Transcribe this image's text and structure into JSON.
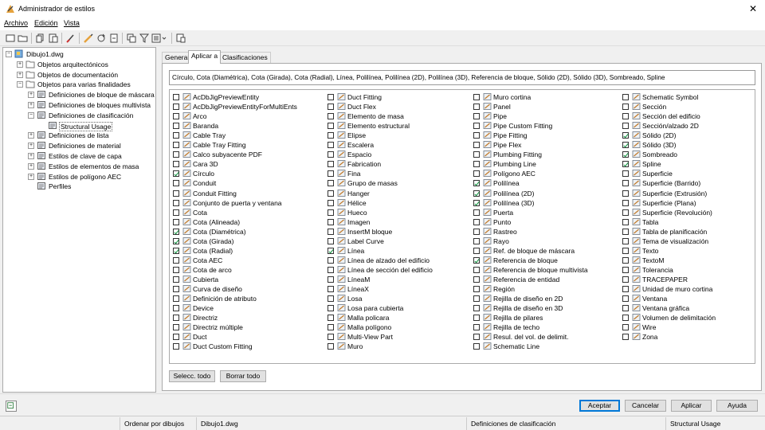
{
  "window": {
    "title": "Administrador de estilos",
    "close_glyph": "✕",
    "icon": "style-manager-icon"
  },
  "menu": [
    {
      "label": "Archivo"
    },
    {
      "label": "Edición"
    },
    {
      "label": "Vista"
    }
  ],
  "toolbar": {
    "icons": [
      "new-drawing-icon",
      "open-drawing-icon",
      "copy-icon",
      "paste-icon",
      "purge-icon",
      "edit-style-icon",
      "synchronize-icon",
      "update-icon",
      "toggle-view-icon",
      "filter-icon",
      "view-options-icon",
      "help-icon"
    ]
  },
  "tree": {
    "nodes": [
      {
        "label": "Dibujo1.dwg",
        "icon": "drawing-icon",
        "expander": "−",
        "level": 0
      },
      {
        "label": "Objetos arquitectónicos",
        "icon": "folder-icon",
        "expander": "+",
        "level": 1
      },
      {
        "label": "Objetos de documentación",
        "icon": "folder-icon",
        "expander": "+",
        "level": 1
      },
      {
        "label": "Objetos para varias finalidades",
        "icon": "folder-icon",
        "expander": "−",
        "level": 1
      },
      {
        "label": "Definiciones de bloque de máscara",
        "icon": "mask-block-icon",
        "expander": "+",
        "level": 2
      },
      {
        "label": "Definiciones de bloques multivista",
        "icon": "multiview-block-icon",
        "expander": "+",
        "level": 2
      },
      {
        "label": "Definiciones de clasificación",
        "icon": "classification-icon",
        "expander": "−",
        "level": 2
      },
      {
        "label": "Structural Usage",
        "icon": "classification-item-icon",
        "expander": "",
        "level": 3,
        "selected": true
      },
      {
        "label": "Definiciones de lista",
        "icon": "list-icon",
        "expander": "+",
        "level": 2
      },
      {
        "label": "Definiciones de material",
        "icon": "material-icon",
        "expander": "+",
        "level": 2
      },
      {
        "label": "Estilos de clave de capa",
        "icon": "layer-key-icon",
        "expander": "+",
        "level": 2
      },
      {
        "label": "Estilos de elementos de masa",
        "icon": "mass-element-icon",
        "expander": "+",
        "level": 2
      },
      {
        "label": "Estilos de polígono AEC",
        "icon": "aec-polygon-icon",
        "expander": "+",
        "level": 2
      },
      {
        "label": "Perfiles",
        "icon": "profile-icon",
        "expander": "",
        "level": 2
      }
    ]
  },
  "tabs": [
    {
      "label": "General",
      "active": false
    },
    {
      "label": "Aplicar a",
      "active": true
    },
    {
      "label": "Clasificaciones",
      "active": false
    }
  ],
  "applies_to_text": "Círculo, Cota (Diamétrica), Cota (Girada), Cota (Radial), Línea, Polilínea, Polilínea (2D), Polilínea (3D), Referencia de bloque, Sólido (2D), Sólido (3D), Sombreado, Spline",
  "objects": {
    "columns": [
      [
        {
          "label": "AcDbJigPreviewEntity",
          "checked": false,
          "icon": "pencil-icon"
        },
        {
          "label": "AcDbJigPreviewEntityForMultiEnts",
          "checked": false,
          "icon": "pencil-icon"
        },
        {
          "label": "Arco",
          "checked": false,
          "icon": "arc-icon"
        },
        {
          "label": "Baranda",
          "checked": false,
          "icon": "railing-icon"
        },
        {
          "label": "Cable Tray",
          "checked": false,
          "icon": "cable-tray-icon"
        },
        {
          "label": "Cable Tray Fitting",
          "checked": false,
          "icon": "cable-tray-fitting-icon"
        },
        {
          "label": "Calco subyacente PDF",
          "checked": false,
          "icon": "pdf-underlay-icon"
        },
        {
          "label": "Cara 3D",
          "checked": false,
          "icon": "face-3d-icon"
        },
        {
          "label": "Círculo",
          "checked": true,
          "icon": "circle-icon"
        },
        {
          "label": "Conduit",
          "checked": false,
          "icon": "conduit-icon"
        },
        {
          "label": "Conduit Fitting",
          "checked": false,
          "icon": "conduit-fitting-icon"
        },
        {
          "label": "Conjunto de puerta y ventana",
          "checked": false,
          "icon": "door-window-assembly-icon"
        },
        {
          "label": "Cota",
          "checked": false,
          "icon": "dimension-icon"
        },
        {
          "label": "Cota (Alineada)",
          "checked": false,
          "icon": "dimension-icon"
        },
        {
          "label": "Cota (Diamétrica)",
          "checked": true,
          "icon": "dimension-icon"
        },
        {
          "label": "Cota (Girada)",
          "checked": true,
          "icon": "dimension-icon"
        },
        {
          "label": "Cota (Radial)",
          "checked": true,
          "icon": "dimension-icon"
        },
        {
          "label": "Cota AEC",
          "checked": false,
          "icon": "aec-dimension-icon"
        },
        {
          "label": "Cota de arco",
          "checked": false,
          "icon": "arc-dimension-icon"
        },
        {
          "label": "Cubierta",
          "checked": false,
          "icon": "roof-icon"
        },
        {
          "label": "Curva de diseño",
          "checked": false,
          "icon": "layout-curve-icon"
        },
        {
          "label": "Definición de atributo",
          "checked": false,
          "icon": "attribute-icon"
        },
        {
          "label": "Device",
          "checked": false,
          "icon": "device-icon"
        },
        {
          "label": "Directriz",
          "checked": false,
          "icon": "leader-icon"
        },
        {
          "label": "Directriz múltiple",
          "checked": false,
          "icon": "multileader-icon"
        },
        {
          "label": "Duct",
          "checked": false,
          "icon": "duct-icon"
        },
        {
          "label": "Duct Custom Fitting",
          "checked": false,
          "icon": "duct-fitting-icon"
        }
      ],
      [
        {
          "label": "Duct Fitting",
          "checked": false,
          "icon": "duct-fitting-icon"
        },
        {
          "label": "Duct Flex",
          "checked": false,
          "icon": "duct-flex-icon"
        },
        {
          "label": "Elemento de masa",
          "checked": false,
          "icon": "mass-element-icon"
        },
        {
          "label": "Elemento estructural",
          "checked": false,
          "icon": "structural-member-icon"
        },
        {
          "label": "Elipse",
          "checked": false,
          "icon": "ellipse-icon"
        },
        {
          "label": "Escalera",
          "checked": false,
          "icon": "stair-icon"
        },
        {
          "label": "Espacio",
          "checked": false,
          "icon": "space-icon"
        },
        {
          "label": "Fabrication",
          "checked": false,
          "icon": "fabrication-icon"
        },
        {
          "label": "Fina",
          "checked": false,
          "icon": "bulb-icon"
        },
        {
          "label": "Grupo de masas",
          "checked": false,
          "icon": "mass-group-icon"
        },
        {
          "label": "Hanger",
          "checked": false,
          "icon": "hanger-icon"
        },
        {
          "label": "Hélice",
          "checked": false,
          "icon": "helix-icon"
        },
        {
          "label": "Hueco",
          "checked": false,
          "icon": "opening-icon"
        },
        {
          "label": "Imagen",
          "checked": false,
          "icon": "image-icon"
        },
        {
          "label": "InsertM bloque",
          "checked": false,
          "icon": "minsert-icon"
        },
        {
          "label": "Label Curve",
          "checked": false,
          "icon": "label-curve-icon"
        },
        {
          "label": "Línea",
          "checked": true,
          "icon": "line-icon"
        },
        {
          "label": "Línea de alzado del edificio",
          "checked": false,
          "icon": "elevation-line-icon"
        },
        {
          "label": "Línea de sección del edificio",
          "checked": false,
          "icon": "section-line-icon"
        },
        {
          "label": "LíneaM",
          "checked": false,
          "icon": "mline-icon"
        },
        {
          "label": "LíneaX",
          "checked": false,
          "icon": "xline-icon"
        },
        {
          "label": "Losa",
          "checked": false,
          "icon": "slab-icon"
        },
        {
          "label": "Losa para cubierta",
          "checked": false,
          "icon": "roof-slab-icon"
        },
        {
          "label": "Malla policara",
          "checked": false,
          "icon": "polyface-mesh-icon"
        },
        {
          "label": "Malla polígono",
          "checked": false,
          "icon": "polygon-mesh-icon"
        },
        {
          "label": "Multi-View Part",
          "checked": false,
          "icon": "multiview-part-icon"
        },
        {
          "label": "Muro",
          "checked": false,
          "icon": "wall-icon"
        }
      ],
      [
        {
          "label": "Muro cortina",
          "checked": false,
          "icon": "curtain-wall-icon"
        },
        {
          "label": "Panel",
          "checked": false,
          "icon": "panel-icon"
        },
        {
          "label": "Pipe",
          "checked": false,
          "icon": "pipe-icon"
        },
        {
          "label": "Pipe Custom Fitting",
          "checked": false,
          "icon": "pipe-fitting-icon"
        },
        {
          "label": "Pipe Fitting",
          "checked": false,
          "icon": "pipe-fitting-icon"
        },
        {
          "label": "Pipe Flex",
          "checked": false,
          "icon": "pipe-flex-icon"
        },
        {
          "label": "Plumbing Fitting",
          "checked": false,
          "icon": "plumbing-fitting-icon"
        },
        {
          "label": "Plumbing Line",
          "checked": false,
          "icon": "plumbing-line-icon"
        },
        {
          "label": "Polígono AEC",
          "checked": false,
          "icon": "aec-polygon-icon"
        },
        {
          "label": "Polilínea",
          "checked": true,
          "icon": "polyline-icon"
        },
        {
          "label": "Polilínea (2D)",
          "checked": true,
          "icon": "polyline-icon"
        },
        {
          "label": "Polilínea (3D)",
          "checked": true,
          "icon": "polyline-icon"
        },
        {
          "label": "Puerta",
          "checked": false,
          "icon": "door-icon"
        },
        {
          "label": "Punto",
          "checked": false,
          "icon": "point-icon"
        },
        {
          "label": "Rastreo",
          "checked": false,
          "icon": "trace-icon"
        },
        {
          "label": "Rayo",
          "checked": false,
          "icon": "ray-icon"
        },
        {
          "label": "Ref. de bloque de máscara",
          "checked": false,
          "icon": "mask-block-ref-icon"
        },
        {
          "label": "Referencia de bloque",
          "checked": true,
          "icon": "block-ref-icon"
        },
        {
          "label": "Referencia de bloque multivista",
          "checked": false,
          "icon": "multiview-block-ref-icon"
        },
        {
          "label": "Referencia de entidad",
          "checked": false,
          "icon": "entity-ref-icon"
        },
        {
          "label": "Región",
          "checked": false,
          "icon": "region-icon"
        },
        {
          "label": "Rejilla de diseño en 2D",
          "checked": false,
          "icon": "grid-2d-icon"
        },
        {
          "label": "Rejilla de diseño en 3D",
          "checked": false,
          "icon": "grid-3d-icon"
        },
        {
          "label": "Rejilla de pilares",
          "checked": false,
          "icon": "column-grid-icon"
        },
        {
          "label": "Rejilla de techo",
          "checked": false,
          "icon": "ceiling-grid-icon"
        },
        {
          "label": "Resul. del vol. de delimit.",
          "checked": false,
          "icon": "bounding-volume-icon"
        },
        {
          "label": "Schematic Line",
          "checked": false,
          "icon": "schematic-line-icon"
        }
      ],
      [
        {
          "label": "Schematic Symbol",
          "checked": false,
          "icon": "schematic-symbol-icon"
        },
        {
          "label": "Sección",
          "checked": false,
          "icon": "section-icon"
        },
        {
          "label": "Sección del edificio",
          "checked": false,
          "icon": "building-section-icon"
        },
        {
          "label": "Sección/alzado 2D",
          "checked": false,
          "icon": "section-elevation-icon"
        },
        {
          "label": "Sólido (2D)",
          "checked": true,
          "icon": "solid-2d-icon"
        },
        {
          "label": "Sólido (3D)",
          "checked": true,
          "icon": "solid-3d-icon"
        },
        {
          "label": "Sombreado",
          "checked": true,
          "icon": "hatch-icon"
        },
        {
          "label": "Spline",
          "checked": true,
          "icon": "spline-icon"
        },
        {
          "label": "Superficie",
          "checked": false,
          "icon": "surface-icon"
        },
        {
          "label": "Superficie (Barrido)",
          "checked": false,
          "icon": "surface-icon"
        },
        {
          "label": "Superficie (Extrusión)",
          "checked": false,
          "icon": "surface-icon"
        },
        {
          "label": "Superficie (Plana)",
          "checked": false,
          "icon": "surface-icon"
        },
        {
          "label": "Superficie (Revolución)",
          "checked": false,
          "icon": "surface-icon"
        },
        {
          "label": "Tabla",
          "checked": false,
          "icon": "table-icon"
        },
        {
          "label": "Tabla de planificación",
          "checked": false,
          "icon": "schedule-table-icon"
        },
        {
          "label": "Tema de visualización",
          "checked": false,
          "icon": "display-theme-icon"
        },
        {
          "label": "Texto",
          "checked": false,
          "icon": "text-icon"
        },
        {
          "label": "TextoM",
          "checked": false,
          "icon": "mtext-icon"
        },
        {
          "label": "Tolerancia",
          "checked": false,
          "icon": "tolerance-icon"
        },
        {
          "label": "TRACEPAPER",
          "checked": false,
          "icon": "tracepaper-icon"
        },
        {
          "label": "Unidad de muro cortina",
          "checked": false,
          "icon": "curtain-wall-unit-icon"
        },
        {
          "label": "Ventana",
          "checked": false,
          "icon": "window-icon"
        },
        {
          "label": "Ventana gráfica",
          "checked": false,
          "icon": "viewport-icon"
        },
        {
          "label": "Volumen de delimitación",
          "checked": false,
          "icon": "bounding-volume-icon"
        },
        {
          "label": "Wire",
          "checked": false,
          "icon": "wire-icon"
        },
        {
          "label": "Zona",
          "checked": false,
          "icon": "zone-icon"
        }
      ]
    ]
  },
  "panel_buttons": {
    "select_all": "Selecc. todo",
    "clear_all": "Borrar todo"
  },
  "dialog_buttons": {
    "ok": "Aceptar",
    "cancel": "Cancelar",
    "apply": "Aplicar",
    "help": "Ayuda"
  },
  "statusbar": {
    "sort": "Ordenar por dibujos",
    "drawing": "Dibujo1.dwg",
    "category": "Definiciones de clasificación",
    "item": "Structural Usage"
  },
  "colors": {
    "check": "#0a8f3a",
    "folder": "#e8c060",
    "accent": "#0078d7"
  }
}
